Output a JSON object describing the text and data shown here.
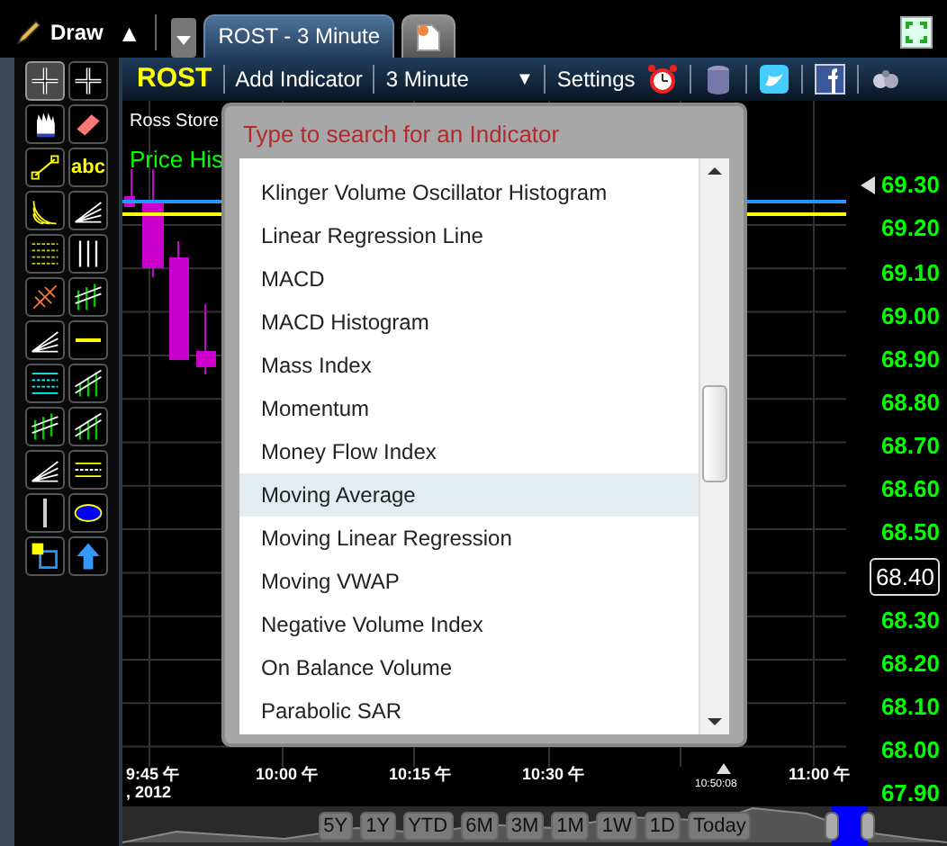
{
  "top_bar": {
    "draw_label": "Draw",
    "draw_caret": "▲",
    "tabs": [
      {
        "kind": "chart",
        "label": "ROST - 3 Minute",
        "selected": true
      },
      {
        "kind": "new-tab",
        "selected": false
      }
    ]
  },
  "drawing_tools": [
    {
      "selected": true
    },
    {
      "selected": false
    },
    {
      "selected": false
    },
    {
      "selected": false
    },
    {
      "selected": false
    },
    {
      "selected": false,
      "label": "abc"
    },
    {
      "selected": false
    },
    {
      "selected": false
    },
    {
      "selected": false
    },
    {
      "selected": false
    },
    {
      "selected": false
    },
    {
      "selected": false
    },
    {
      "selected": false
    },
    {
      "selected": false
    },
    {
      "selected": false
    },
    {
      "selected": false
    },
    {
      "selected": false
    },
    {
      "selected": false
    },
    {
      "selected": false
    },
    {
      "selected": false
    },
    {
      "selected": false
    },
    {
      "selected": false
    },
    {
      "selected": false
    },
    {
      "selected": false
    }
  ],
  "toolbar": {
    "symbol": "ROST",
    "add_indicator": "Add Indicator",
    "interval": "3 Minute",
    "interval_caret": "▼",
    "settings": "Settings"
  },
  "chart": {
    "company": "Ross Store",
    "study": "Price His",
    "price_axis": [
      {
        "label": "69.30",
        "kind": "marked"
      },
      {
        "label": "69.20",
        "kind": "plain"
      },
      {
        "label": "69.10",
        "kind": "plain"
      },
      {
        "label": "69.00",
        "kind": "plain"
      },
      {
        "label": "68.90",
        "kind": "plain"
      },
      {
        "label": "68.80",
        "kind": "plain"
      },
      {
        "label": "68.70",
        "kind": "plain"
      },
      {
        "label": "68.60",
        "kind": "plain"
      },
      {
        "label": "68.50",
        "kind": "plain"
      },
      {
        "label": "68.40",
        "kind": "current"
      },
      {
        "label": "68.30",
        "kind": "plain"
      },
      {
        "label": "68.20",
        "kind": "plain"
      },
      {
        "label": "68.10",
        "kind": "plain"
      },
      {
        "label": "68.00",
        "kind": "plain"
      },
      {
        "label": "67.90",
        "kind": "plain"
      }
    ],
    "time_axis": [
      {
        "label": "9:45 午",
        "sub": ", 2012",
        "kind": "tick"
      },
      {
        "label": "10:00 午",
        "kind": "tick"
      },
      {
        "label": "10:15 午",
        "kind": "tick"
      },
      {
        "label": "10:30 午",
        "kind": "tick"
      },
      {
        "label": "10:50:08",
        "kind": "small"
      },
      {
        "label": "11:00 午",
        "kind": "tick"
      }
    ]
  },
  "navigator": {
    "ranges": [
      "5Y",
      "1Y",
      "YTD",
      "6M",
      "3M",
      "1M",
      "1W",
      "1D",
      "Today"
    ]
  },
  "indicator_picker": {
    "placeholder": "Type to search for an Indicator",
    "items": [
      {
        "label": "Klinger Volume Oscillator Histogram",
        "selected": false
      },
      {
        "label": "Linear Regression Line",
        "selected": false
      },
      {
        "label": "MACD",
        "selected": false
      },
      {
        "label": "MACD Histogram",
        "selected": false
      },
      {
        "label": "Mass Index",
        "selected": false
      },
      {
        "label": "Momentum",
        "selected": false
      },
      {
        "label": "Money Flow Index",
        "selected": false
      },
      {
        "label": "Moving Average",
        "selected": true
      },
      {
        "label": "Moving Linear Regression",
        "selected": false
      },
      {
        "label": "Moving VWAP",
        "selected": false
      },
      {
        "label": "Negative Volume Index",
        "selected": false
      },
      {
        "label": "On Balance Volume",
        "selected": false
      },
      {
        "label": "Parabolic SAR",
        "selected": false
      }
    ]
  }
}
